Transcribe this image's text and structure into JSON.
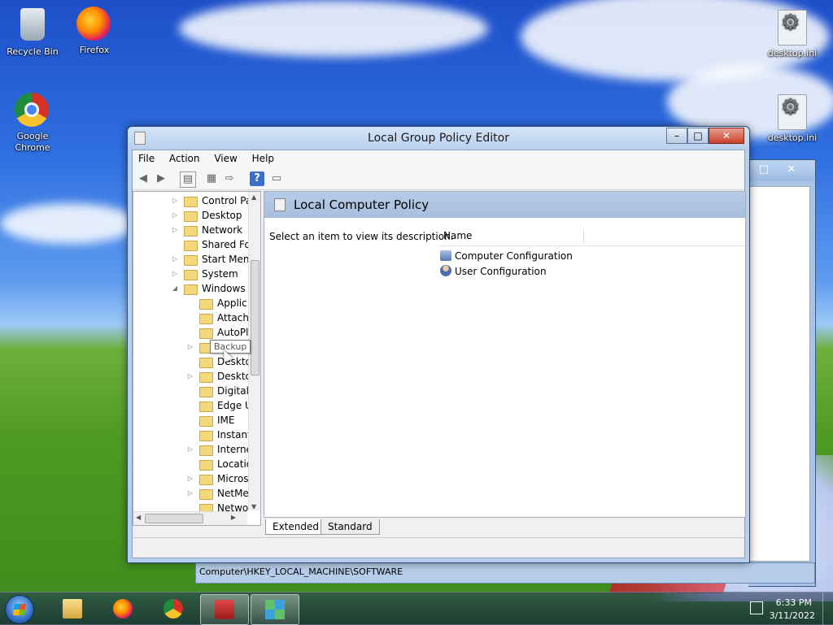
{
  "desktop": {
    "icons": [
      {
        "label": "Recycle Bin"
      },
      {
        "label": "Firefox"
      },
      {
        "label": "Google Chrome"
      },
      {
        "label": "desktop.ini"
      },
      {
        "label": "desktop.ini"
      }
    ]
  },
  "window": {
    "title": "Local Group Policy Editor",
    "menu": [
      "File",
      "Action",
      "View",
      "Help"
    ],
    "toolbar_icons": [
      "back-icon",
      "forward-icon",
      "show-hide-console-tree-icon",
      "properties-icon",
      "export-list-icon",
      "help-icon",
      "extended-view-icon"
    ],
    "tree": [
      {
        "label": "Control Pa",
        "expander": "collapsed"
      },
      {
        "label": "Desktop",
        "expander": "collapsed"
      },
      {
        "label": "Network",
        "expander": "collapsed"
      },
      {
        "label": "Shared Fol",
        "expander": "none"
      },
      {
        "label": "Start Menu",
        "expander": "collapsed"
      },
      {
        "label": "System",
        "expander": "collapsed"
      },
      {
        "label": "Windows ",
        "expander": "expanded"
      },
      {
        "label": "Applic",
        "expander": "none"
      },
      {
        "label": "Attach",
        "expander": "none"
      },
      {
        "label": "AutoPl",
        "expander": "none"
      },
      {
        "label": "Backup",
        "expander": "collapsed"
      },
      {
        "label": "Deskto",
        "expander": "none"
      },
      {
        "label": "Deskto",
        "expander": "collapsed"
      },
      {
        "label": "Digital",
        "expander": "none"
      },
      {
        "label": "Edge U",
        "expander": "none"
      },
      {
        "label": "IME",
        "expander": "none"
      },
      {
        "label": "Instant",
        "expander": "none"
      },
      {
        "label": "Interne",
        "expander": "collapsed"
      },
      {
        "label": "Locatio",
        "expander": "none"
      },
      {
        "label": "Micros",
        "expander": "collapsed"
      },
      {
        "label": "NetMe",
        "expander": "collapsed"
      },
      {
        "label": "Netwo",
        "expander": "none"
      }
    ],
    "tooltip": "Backup",
    "right": {
      "header": "Local Computer Policy",
      "description": "Select an item to view its description.",
      "column": "Name",
      "items": [
        "Computer Configuration",
        "User Configuration"
      ]
    },
    "tabs": [
      "Extended",
      "Standard"
    ]
  },
  "registry": {
    "status_path": "Computer\\HKEY_LOCAL_MACHINE\\SOFTWARE"
  },
  "taskbar": {
    "time": "6:33 PM",
    "date": "3/11/2022"
  }
}
